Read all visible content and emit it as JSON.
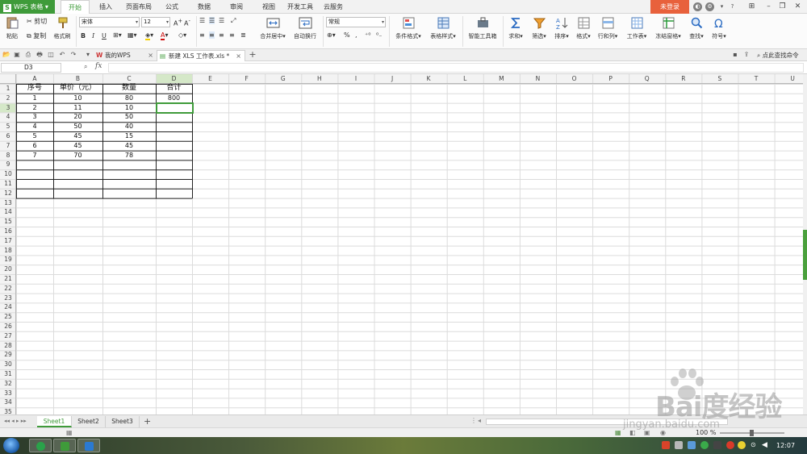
{
  "app": {
    "logo_text": "WPS 表格",
    "login_label": "未登录"
  },
  "menu_tabs": [
    "开始",
    "插入",
    "页面布局",
    "公式",
    "数据",
    "审阅",
    "视图",
    "开发工具",
    "云服务"
  ],
  "ribbon": {
    "paste": "粘贴",
    "cut": "剪切",
    "copy": "复制",
    "format_painter": "格式刷",
    "font_name": "宋体",
    "font_size": "12",
    "merge_center": "合并居中",
    "wrap_text": "自动换行",
    "number_format": "常规",
    "conditional_format": "条件格式",
    "table_style": "表格样式",
    "smart_toolbox": "智能工具箱",
    "sum": "求和",
    "filter": "筛选",
    "sort": "排序",
    "format": "格式",
    "row_col": "行和列",
    "worksheet": "工作表",
    "freeze": "冻结窗格",
    "find": "查找",
    "symbol": "符号",
    "percent": "%",
    "comma": ","
  },
  "doc_tabs": [
    {
      "label": "我的WPS"
    },
    {
      "label": "新建 XLS 工作表.xls *"
    }
  ],
  "search_cmd": "点此查找命令",
  "formula_bar": {
    "cell_ref": "D3",
    "fx": "fx",
    "content": ""
  },
  "grid": {
    "columns": [
      "A",
      "B",
      "C",
      "D",
      "E",
      "F",
      "G",
      "H",
      "I",
      "J",
      "K",
      "L",
      "M",
      "N",
      "O",
      "P",
      "Q",
      "R",
      "S",
      "T",
      "U"
    ],
    "rows": [
      "1",
      "2",
      "3",
      "4",
      "5",
      "6",
      "7",
      "8",
      "9",
      "10",
      "11",
      "12",
      "13",
      "14",
      "15",
      "16",
      "17",
      "18",
      "19",
      "20",
      "21",
      "22",
      "23",
      "24",
      "25",
      "26",
      "27",
      "28",
      "29",
      "30",
      "31",
      "32",
      "33",
      "34",
      "35"
    ],
    "selected_cell": "D3",
    "cells": [
      [
        "序号",
        "单价（元）",
        "数量",
        "合计"
      ],
      [
        "1",
        "10",
        "80",
        "800"
      ],
      [
        "2",
        "11",
        "10",
        ""
      ],
      [
        "3",
        "20",
        "50",
        ""
      ],
      [
        "4",
        "50",
        "40",
        ""
      ],
      [
        "5",
        "45",
        "15",
        ""
      ],
      [
        "6",
        "45",
        "45",
        ""
      ],
      [
        "7",
        "70",
        "78",
        ""
      ]
    ]
  },
  "sheets": [
    "Sheet1",
    "Sheet2",
    "Sheet3"
  ],
  "active_sheet": "Sheet1",
  "status": {
    "zoom": "100 %"
  },
  "taskbar": {
    "clock": "12:07"
  },
  "watermark": {
    "brand": "Bai度经验",
    "url": "jingyan.baidu.com"
  }
}
